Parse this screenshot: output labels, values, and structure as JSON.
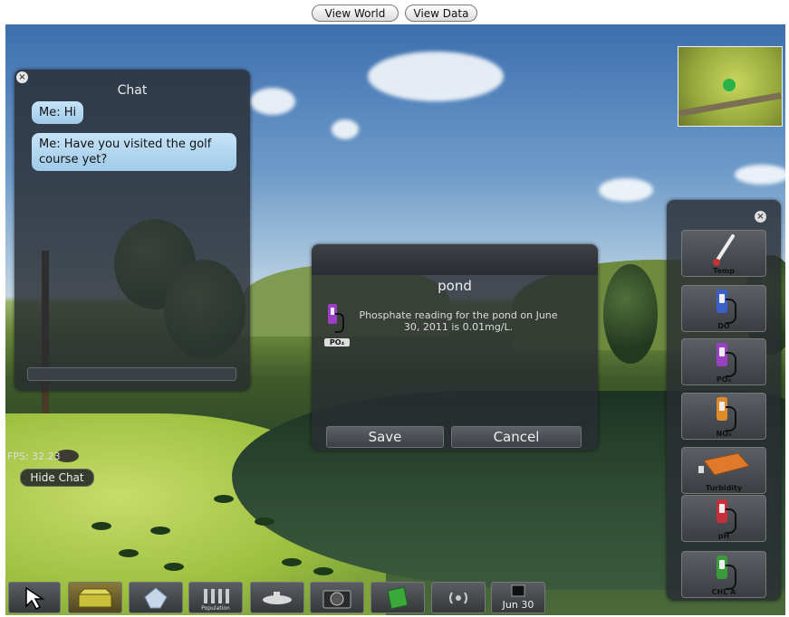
{
  "topbar": {
    "view_world": "View World",
    "view_data": "View Data"
  },
  "chat": {
    "title": "Chat",
    "close_icon": "close-icon",
    "messages": [
      "Me: Hi",
      "Me: Have you visited the golf course yet?"
    ],
    "input_value": ""
  },
  "hud": {
    "fps": "FPS: 32.23",
    "hide_chat": "Hide Chat"
  },
  "dialog": {
    "title": "pond",
    "probe_label": "PO₄",
    "message": "Phosphate reading for the pond on June 30, 2011 is 0.01mg/L.",
    "save": "Save",
    "cancel": "Cancel"
  },
  "instruments": {
    "close_icon": "close-icon",
    "items": [
      {
        "label": "Temp",
        "icon": "thermometer-icon",
        "color": "#c33333"
      },
      {
        "label": "DO",
        "icon": "probe-icon",
        "color": "#3a5fc8"
      },
      {
        "label": "PO₄",
        "icon": "probe-icon",
        "color": "#9b3fc4"
      },
      {
        "label": "NO₃",
        "icon": "probe-icon",
        "color": "#e08a2a"
      },
      {
        "label": "Turbidity",
        "icon": "turbidity-meter-icon",
        "color": "#e07a2a"
      },
      {
        "label": "pH",
        "icon": "probe-icon",
        "color": "#c42f3a"
      },
      {
        "label": "CHL A",
        "icon": "probe-icon",
        "color": "#3a9b3a"
      }
    ]
  },
  "toolbar": {
    "items": [
      {
        "name": "pointer",
        "icon": "cursor-arrow-icon"
      },
      {
        "name": "kit",
        "icon": "field-kit-icon"
      },
      {
        "name": "crystal",
        "icon": "crystal-icon"
      },
      {
        "name": "population",
        "icon": "population-icon",
        "label": "Population"
      },
      {
        "name": "submarine",
        "icon": "submarine-icon"
      },
      {
        "name": "camera",
        "icon": "camera-icon"
      },
      {
        "name": "notebook",
        "icon": "notebook-icon"
      },
      {
        "name": "broadcast",
        "icon": "broadcast-icon"
      },
      {
        "name": "calendar",
        "icon": "calendar-icon",
        "label": "Jun 30"
      }
    ]
  },
  "colors": {
    "chat_bubble": "#b3d8f1",
    "panel_bg": "#2a2d31",
    "accent_green": "#28b34a"
  }
}
